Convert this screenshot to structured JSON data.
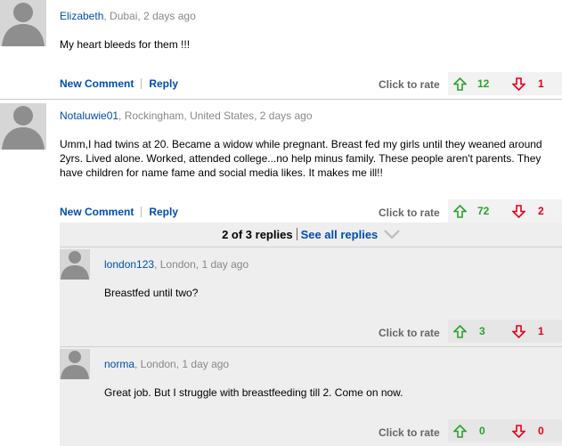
{
  "comments": [
    {
      "author": "Elizabeth",
      "meta": ", Dubai, 2 days ago",
      "text": "My heart bleeds for them !!!",
      "new_comment": "New Comment",
      "reply": "Reply",
      "click_to_rate": "Click to rate",
      "up_votes": "12",
      "down_votes": "1"
    },
    {
      "author": "Notaluwie01",
      "meta": ", Rockingham, United States, 2 days ago",
      "text": "Umm,I had twins at 20. Became a widow while pregnant. Breast fed my girls until they weaned around 2yrs. Lived alone. Worked, attended college...no help minus family. These people aren't parents. They have children for name fame and social media likes. It makes me ill!!",
      "new_comment": "New Comment",
      "reply": "Reply",
      "click_to_rate": "Click to rate",
      "up_votes": "72",
      "down_votes": "2"
    }
  ],
  "replies_header": {
    "count": "2 of 3 replies",
    "see_all": "See all replies"
  },
  "replies": [
    {
      "author": "london123",
      "meta": ", London, 1 day ago",
      "text": "Breastfed until two?",
      "click_to_rate": "Click to rate",
      "up_votes": "3",
      "down_votes": "1"
    },
    {
      "author": "norma",
      "meta": ", London, 1 day ago",
      "text": "Great job. But I struggle with breastfeeding till 2. Come on now.",
      "click_to_rate": "Click to rate",
      "up_votes": "0",
      "down_votes": "0"
    }
  ],
  "colors": {
    "link": "#004db3",
    "up": "#29a329",
    "down": "#e3001b",
    "reply_bg": "#eeeeee"
  },
  "icons": {
    "avatar": "default-avatar-icon",
    "up": "thumb-up-arrow-icon",
    "down": "thumb-down-arrow-icon",
    "chevron": "chevron-down-icon"
  }
}
